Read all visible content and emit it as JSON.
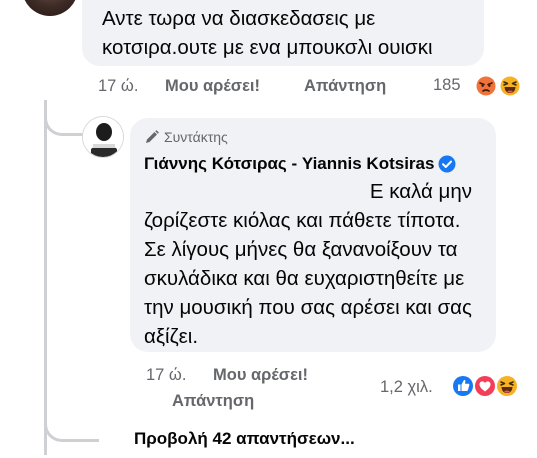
{
  "comment1": {
    "text": "Αντε τωρα να διασκεδασεις με κοτσιρα.ουτε με ενα μπουκσλι ουισκι",
    "time": "17 ώ.",
    "like_label": "Μου αρέσει!",
    "reply_label": "Απάντηση",
    "reaction_count": "185",
    "reactions": [
      "angry-icon",
      "haha-icon"
    ]
  },
  "reply": {
    "badge": "Συντάκτης",
    "author": "Γιάννης Κότσιρας - Yiannis Kotsiras",
    "text_line1": "Ε καλά μην",
    "text_rest": "ζορίζεστε κιόλας και πάθετε τίποτα. Σε λίγους μήνες θα ξανανοίξουν τα σκυλάδικα και θα ευχαριστηθείτε με την μουσική που σας αρέσει και σας αξίζει.",
    "time": "17 ώ.",
    "like_label": "Μου αρέσει!",
    "reply_label": "Απάντηση",
    "reaction_count": "1,2 χιλ.",
    "reactions": [
      "like-icon",
      "love-icon",
      "haha-icon"
    ]
  },
  "view_replies": "Προβολή 42 απαντήσεων...",
  "colors": {
    "bubble": "#f0f2f5",
    "meta_text": "#65676b",
    "like_blue": "#1877f2",
    "love_red": "#f33e58",
    "emoji_yellow": "#f7b125"
  }
}
